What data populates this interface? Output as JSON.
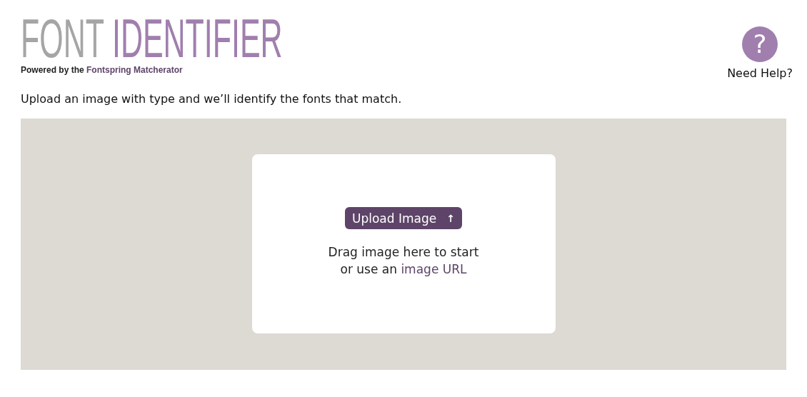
{
  "header": {
    "title_part_1": "FONT",
    "title_part_2": "IDENTIFIER",
    "tagline_prefix": "Powered by the",
    "tagline_link": "Fontspring Matcherator"
  },
  "help": {
    "symbol": "?",
    "label": "Need Help?"
  },
  "intro": "Upload an image with type and we’ll identify the fonts that match.",
  "upload": {
    "button": "Upload Image",
    "button_icon": "↑",
    "drag_text": "Drag image here to start",
    "url_prefix": "or use an",
    "url_link": "image URL"
  }
}
